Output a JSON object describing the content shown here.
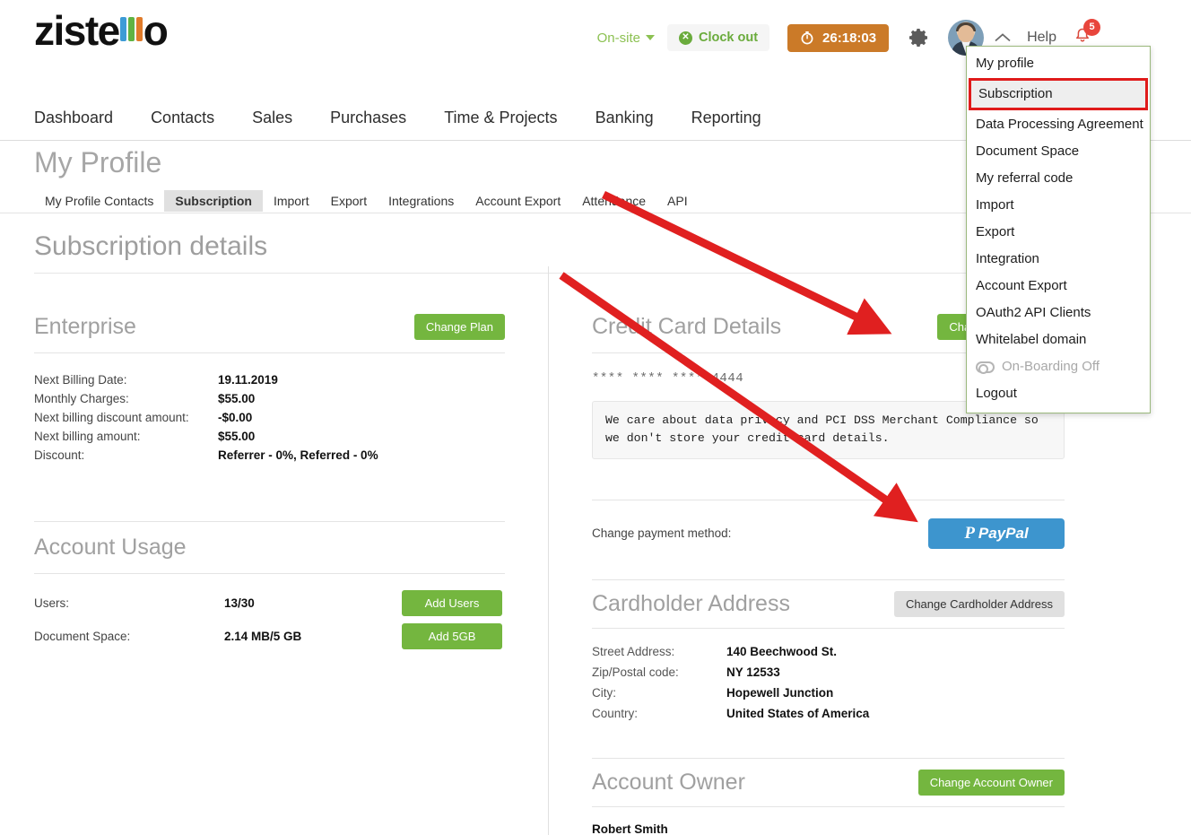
{
  "brand": {
    "name": "zistemo",
    "text_part": "ziste",
    "tail": "o",
    "bar_colors": [
      "#3d9bd6",
      "#5fb343",
      "#e07b2a"
    ]
  },
  "topbar": {
    "onsite_label": "On-site",
    "clock_out_label": "Clock out",
    "timer_value": "26:18:03",
    "help_label": "Help",
    "notification_count": "5"
  },
  "mainnav": {
    "items": [
      {
        "label": "Dashboard"
      },
      {
        "label": "Contacts"
      },
      {
        "label": "Sales"
      },
      {
        "label": "Purchases"
      },
      {
        "label": "Time & Projects"
      },
      {
        "label": "Banking"
      },
      {
        "label": "Reporting"
      }
    ]
  },
  "page": {
    "title": "My Profile",
    "heading": "Subscription details"
  },
  "tabs": [
    {
      "label": "My Profile Contacts",
      "active": false
    },
    {
      "label": "Subscription",
      "active": true
    },
    {
      "label": "Import",
      "active": false
    },
    {
      "label": "Export",
      "active": false
    },
    {
      "label": "Integrations",
      "active": false
    },
    {
      "label": "Account Export",
      "active": false
    },
    {
      "label": "Attendance",
      "active": false
    },
    {
      "label": "API",
      "active": false
    }
  ],
  "user_menu": {
    "items": [
      {
        "label": "My profile",
        "state": "normal"
      },
      {
        "label": "Subscription",
        "state": "selected"
      },
      {
        "label": "Data Processing Agreement",
        "state": "normal"
      },
      {
        "label": "Document Space",
        "state": "normal"
      },
      {
        "label": "My referral code",
        "state": "normal"
      },
      {
        "label": "Import",
        "state": "normal"
      },
      {
        "label": "Export",
        "state": "normal"
      },
      {
        "label": "Integration",
        "state": "normal"
      },
      {
        "label": "Account Export",
        "state": "normal"
      },
      {
        "label": "OAuth2 API Clients",
        "state": "normal"
      },
      {
        "label": "Whitelabel domain",
        "state": "normal"
      },
      {
        "label": "On-Boarding Off",
        "state": "disabled"
      },
      {
        "label": "Logout",
        "state": "normal"
      }
    ]
  },
  "plan": {
    "name": "Enterprise",
    "change_plan_label": "Change Plan",
    "rows": [
      {
        "label": "Next Billing Date:",
        "value": "19.11.2019"
      },
      {
        "label": "Monthly Charges:",
        "value": "$55.00"
      },
      {
        "label": "Next billing discount amount:",
        "value": "-$0.00"
      },
      {
        "label": "Next billing amount:",
        "value": "$55.00"
      },
      {
        "label": "Discount:",
        "value": "Referrer - 0%, Referred - 0%"
      }
    ]
  },
  "account_usage": {
    "heading": "Account Usage",
    "rows": [
      {
        "label": "Users:",
        "value": "13/30",
        "button": "Add Users"
      },
      {
        "label": "Document Space:",
        "value": "2.14 MB/5 GB",
        "button": "Add 5GB"
      }
    ]
  },
  "credit_card": {
    "heading": "Credit Card Details",
    "change_button_label": "Change Credit Card",
    "masked_number": "**** **** **** 4444",
    "pci_notice": "We care about data privacy and PCI DSS Merchant Compliance so we don't store your credit card details.",
    "change_payment_label": "Change payment method:",
    "paypal_label": "PayPal"
  },
  "cardholder_address": {
    "heading": "Cardholder Address",
    "change_button_label": "Change Cardholder Address",
    "rows": [
      {
        "label": "Street Address:",
        "value": "140 Beechwood St."
      },
      {
        "label": "Zip/Postal code:",
        "value": "NY 12533"
      },
      {
        "label": "City:",
        "value": "Hopewell Junction"
      },
      {
        "label": "Country:",
        "value": "United States of America"
      }
    ]
  },
  "account_owner": {
    "heading": "Account Owner",
    "change_button_label": "Change Account Owner",
    "name": "Robert Smith"
  },
  "colors": {
    "green": "#74b63f",
    "orange": "#cb7a28",
    "paypal_blue": "#3d95ce",
    "highlight_red": "#e01b1b",
    "annotation_red": "#e02020"
  }
}
